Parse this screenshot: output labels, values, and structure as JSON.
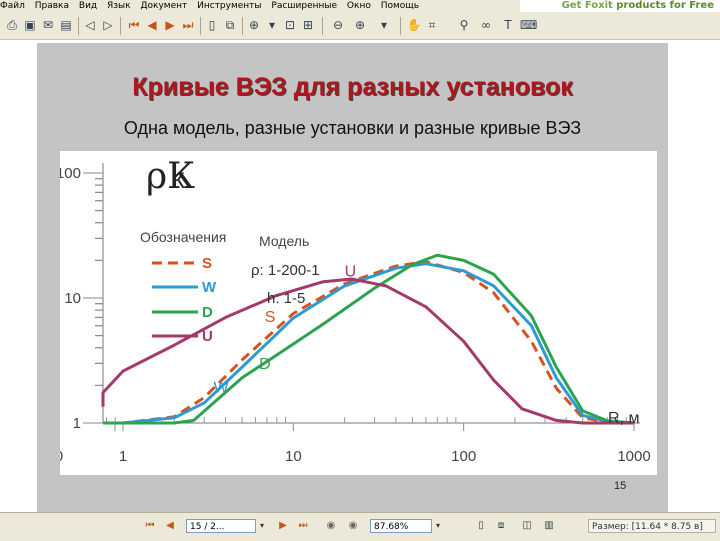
{
  "menu": [
    "Файл",
    "Правка",
    "Вид",
    "Язык",
    "Документ",
    "Инструменты",
    "Расширенные",
    "Окно",
    "Помощь"
  ],
  "promo": {
    "left": "Get Foxit",
    "right": "products for Free"
  },
  "toolbar": {
    "icons": [
      "print-icon",
      "save-icon",
      "email-icon",
      "scanner-icon",
      "back-icon",
      "forward-icon",
      "first-page-icon",
      "prev-page-icon",
      "next-page-icon",
      "last-page-icon",
      "page-view-icon",
      "fit-width-icon",
      "zoom-in-icon",
      "select-icon",
      "fit-page-icon",
      "fit-visible-icon",
      "zoom-out-icon",
      "zoom-plus-icon",
      "hand-icon",
      "snapshot-icon",
      "find-icon",
      "text-select-icon",
      "typewriter-icon"
    ]
  },
  "slide": {
    "title": "Кривые ВЭЗ для разных установок",
    "subtitle": "Одна модель, разные установки и разные кривые ВЭЗ",
    "page_number": "15"
  },
  "chart_data": {
    "type": "line",
    "x_scale": "log",
    "y_scale": "log",
    "xlim": [
      1,
      1000
    ],
    "ylim": [
      1,
      100
    ],
    "x_tick_labels": [
      "0",
      "1",
      "10",
      "100",
      "1000"
    ],
    "y_tick_labels": [
      "100",
      "10",
      "1"
    ],
    "ylabel": "ρК",
    "xlabel": "R, м",
    "legend_title": "Обозначения",
    "model_title": "Модель",
    "model_rho": "ρ: 1-200-1",
    "model_h": "h: 1-5",
    "series": [
      {
        "name": "S",
        "color": "#d8521e",
        "dash": true,
        "points": [
          [
            0.18,
            1
          ],
          [
            1,
            1
          ],
          [
            2,
            1.12
          ],
          [
            3,
            1.6
          ],
          [
            5,
            3.2
          ],
          [
            10,
            7.5
          ],
          [
            20,
            13
          ],
          [
            40,
            18
          ],
          [
            60,
            19.5
          ],
          [
            100,
            16
          ],
          [
            150,
            11
          ],
          [
            250,
            4.5
          ],
          [
            350,
            1.9
          ],
          [
            500,
            1.1
          ],
          [
            700,
            1.02
          ],
          [
            1000,
            1
          ]
        ]
      },
      {
        "name": "W",
        "color": "#2d9ad1",
        "dash": false,
        "points": [
          [
            0.18,
            1
          ],
          [
            1,
            1
          ],
          [
            2,
            1.1
          ],
          [
            3,
            1.45
          ],
          [
            5,
            2.8
          ],
          [
            10,
            6.9
          ],
          [
            20,
            12.5
          ],
          [
            40,
            17.3
          ],
          [
            60,
            18.8
          ],
          [
            100,
            16.5
          ],
          [
            150,
            12.5
          ],
          [
            250,
            6
          ],
          [
            350,
            2.3
          ],
          [
            500,
            1.15
          ],
          [
            700,
            1.03
          ],
          [
            1000,
            1
          ]
        ]
      },
      {
        "name": "D",
        "color": "#2ea34e",
        "dash": false,
        "points": [
          [
            0.18,
            1
          ],
          [
            1,
            1
          ],
          [
            2,
            1
          ],
          [
            2.6,
            1.05
          ],
          [
            3.5,
            1.5
          ],
          [
            5,
            2.3
          ],
          [
            8,
            3.5
          ],
          [
            15,
            6.2
          ],
          [
            30,
            12
          ],
          [
            50,
            18.5
          ],
          [
            70,
            22
          ],
          [
            100,
            20
          ],
          [
            150,
            15.5
          ],
          [
            250,
            7.2
          ],
          [
            350,
            2.8
          ],
          [
            500,
            1.25
          ],
          [
            700,
            1.04
          ],
          [
            1000,
            1
          ]
        ]
      },
      {
        "name": "U",
        "color": "#a23a6a",
        "dash": false,
        "points": [
          [
            0.18,
            1.35
          ],
          [
            0.5,
            1.75
          ],
          [
            1,
            2.6
          ],
          [
            2,
            4.2
          ],
          [
            4,
            7
          ],
          [
            8,
            10.5
          ],
          [
            15,
            13.5
          ],
          [
            22,
            14.2
          ],
          [
            35,
            12.5
          ],
          [
            60,
            8.5
          ],
          [
            100,
            4.5
          ],
          [
            150,
            2.2
          ],
          [
            220,
            1.3
          ],
          [
            350,
            1.05
          ],
          [
            500,
            1
          ],
          [
            1000,
            1
          ]
        ]
      }
    ],
    "curve_labels": [
      {
        "text": "U",
        "series": "U",
        "x": 20,
        "y": 14.8
      },
      {
        "text": "S",
        "series": "S",
        "x": 6.8,
        "y": 6.4
      },
      {
        "text": "W",
        "series": "W",
        "x": 3.4,
        "y": 1.75
      },
      {
        "text": "D",
        "series": "D",
        "x": 6.3,
        "y": 2.7
      }
    ]
  },
  "status": {
    "page_field": "15 / 2...",
    "zoom_field": "87.68%",
    "size_text": "Размер: [11.64 * 8.75 в]"
  }
}
